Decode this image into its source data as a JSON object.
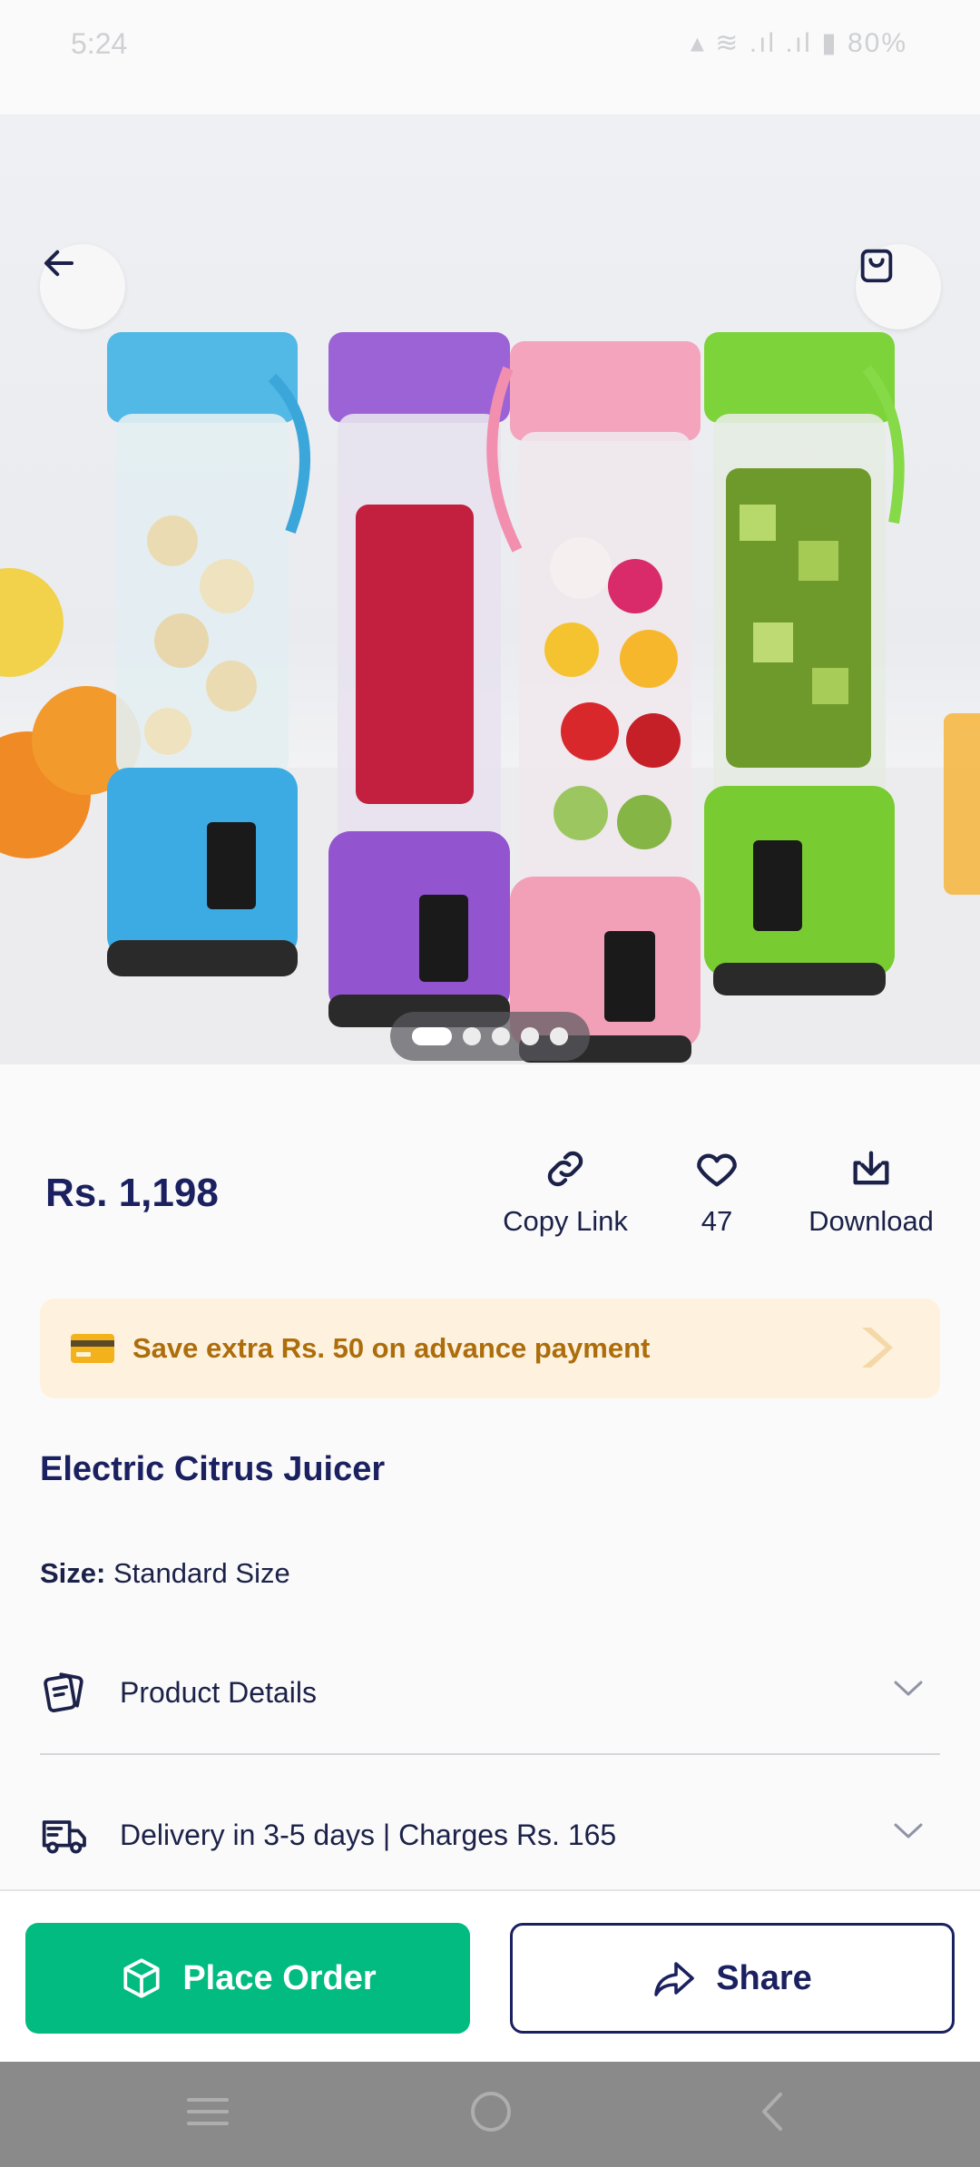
{
  "status_bar": {
    "time": "5:24",
    "battery": "80%"
  },
  "header": {
    "back_icon": "arrow-left-icon",
    "cart_icon": "shopping-bag-icon"
  },
  "gallery": {
    "image_count": 5,
    "active_index": 0
  },
  "product": {
    "price": "Rs. 1,198",
    "title": "Electric Citrus Juicer",
    "size_label": "Size:",
    "size_value": "Standard Size"
  },
  "actions": {
    "copy_link": "Copy Link",
    "likes": "47",
    "download": "Download"
  },
  "promo": {
    "text": "Save extra Rs. 50 on advance payment",
    "icon": "credit-card-icon"
  },
  "accordions": {
    "details": "Product Details",
    "delivery": "Delivery in 3-5 days | Charges Rs. 165"
  },
  "buttons": {
    "place_order": "Place Order",
    "share": "Share"
  },
  "colors": {
    "accent_green": "#02bb80",
    "navy": "#1b2160",
    "promo_bg": "#fef2df",
    "promo_text": "#ad6d0b"
  }
}
